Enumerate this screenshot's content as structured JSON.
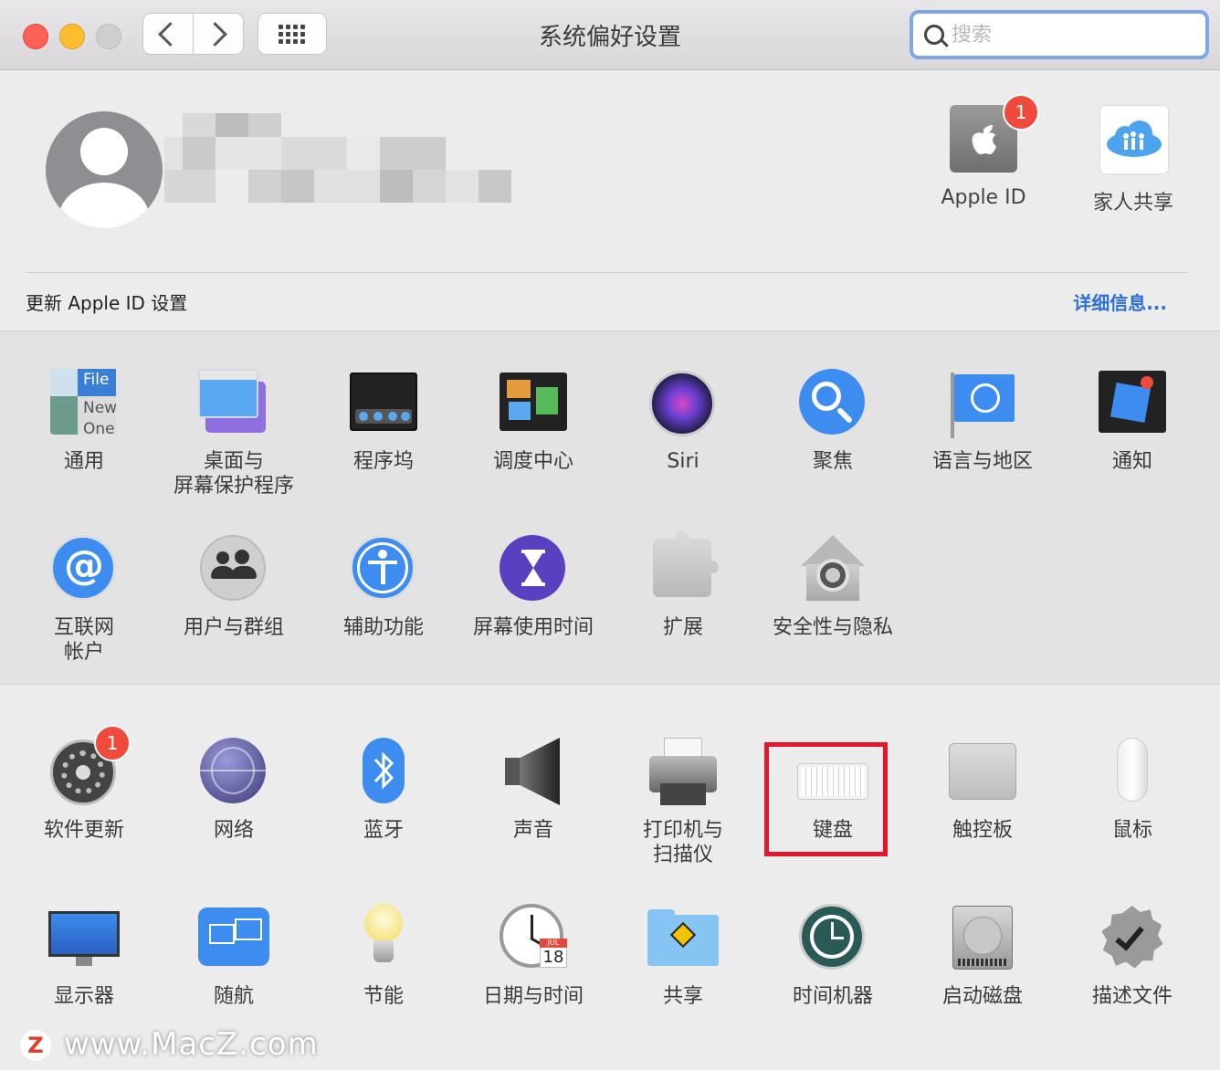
{
  "window": {
    "title": "系统偏好设置"
  },
  "search": {
    "placeholder": "搜索"
  },
  "top_items": [
    {
      "label": "Apple ID",
      "badge": "1"
    },
    {
      "label": "家人共享"
    }
  ],
  "update_bar": {
    "text": "更新 Apple ID 设置",
    "link": "详细信息..."
  },
  "row1": [
    "通用",
    "桌面与\n屏幕保护程序",
    "程序坞",
    "调度中心",
    "Siri",
    "聚焦",
    "语言与地区",
    "通知"
  ],
  "row2": [
    "互联网\n帐户",
    "用户与群组",
    "辅助功能",
    "屏幕使用时间",
    "扩展",
    "安全性与隐私"
  ],
  "row3": [
    "软件更新",
    "网络",
    "蓝牙",
    "声音",
    "打印机与\n扫描仪",
    "键盘",
    "触控板",
    "鼠标"
  ],
  "row4": [
    "显示器",
    "随航",
    "节能",
    "日期与时间",
    "共享",
    "时间机器",
    "启动磁盘",
    "描述文件"
  ],
  "software_update_badge": "1",
  "general_icon_text": [
    "File",
    "New",
    "One"
  ],
  "date_icon": {
    "month": "JUL",
    "day": "18"
  },
  "watermark": {
    "logo": "Z",
    "text": "www.MacZ.com"
  }
}
